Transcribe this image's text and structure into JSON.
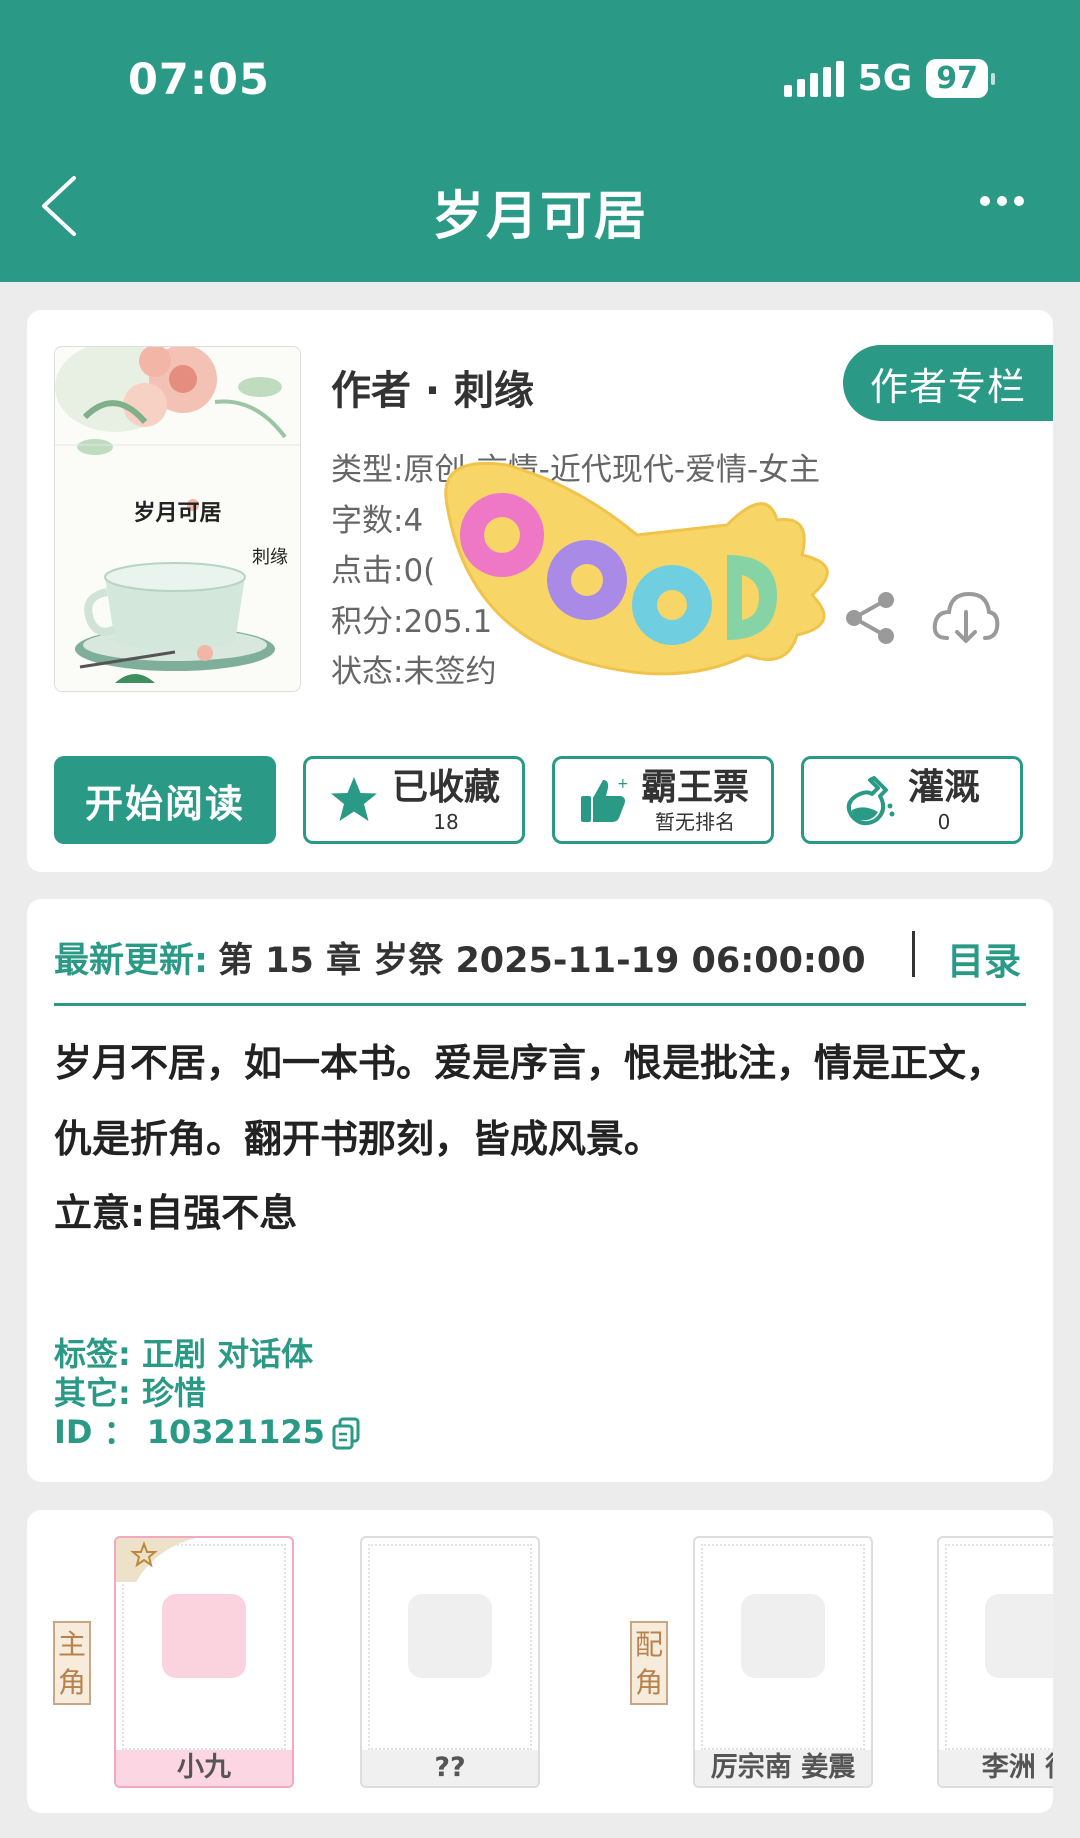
{
  "status_bar": {
    "time": "07:05",
    "network": "5G",
    "battery": "97"
  },
  "nav": {
    "title": "岁月可居"
  },
  "book": {
    "cover_title": "岁月可居",
    "cover_author": "刺缘",
    "author_line": "作者 · 刺缘",
    "author_column_label": "作者专栏",
    "meta": [
      "类型:原创-言情-近代现代-爱情-女主",
      "字数:4",
      "点击:0(",
      "积分:205.1",
      "状态:未签约"
    ]
  },
  "actions": {
    "start_label": "开始阅读",
    "favorite_label": "已收藏",
    "favorite_count": "18",
    "ticket_label": "霸王票",
    "ticket_sub": "暂无排名",
    "nutrient_label": "灌溉",
    "nutrient_count": "0"
  },
  "update": {
    "prefix": "最新更新:",
    "text": "第 15 章 岁祭 2025-11-19 06:00:00",
    "toc_label": "目录"
  },
  "summary": {
    "text": "岁月不居，如一本书。爱是序言，恨是批注，情是正文，仇是折角。翻开书那刻，皆成风景。",
    "idea": "立意:自强不息",
    "tags_line": "标签: 正剧  对话体",
    "other_line": "其它:  珍惜",
    "id_line": "ID   ：  10321125"
  },
  "roles": {
    "main_tag": [
      "主",
      "角"
    ],
    "support_tag": [
      "配",
      "角"
    ],
    "characters": [
      "小九",
      "??",
      "厉宗南 姜震",
      "李洲 徐"
    ]
  },
  "sticker": {
    "text": "GOOD"
  },
  "colors": {
    "accent": "#2a9a87",
    "background": "#ececec"
  }
}
